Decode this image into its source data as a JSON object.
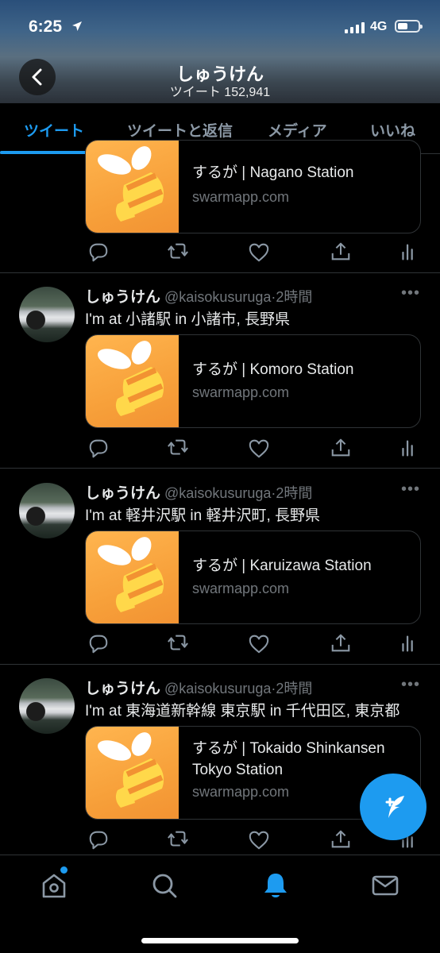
{
  "status_bar": {
    "time": "6:25",
    "network": "4G",
    "battery_level": 0.5
  },
  "header": {
    "profile_name": "しゅうけん",
    "tweet_count": "ツイート 152,941"
  },
  "tabs": [
    {
      "label": "ツイート",
      "active": true
    },
    {
      "label": "ツイートと返信",
      "active": false
    },
    {
      "label": "メディア",
      "active": false
    },
    {
      "label": "いいね",
      "active": false
    }
  ],
  "partial_tweet": {
    "card": {
      "title": "するが | Nagano Station",
      "domain": "swarmapp.com"
    }
  },
  "tweets": [
    {
      "name": "しゅうけん",
      "handle": "@kaisokusuruga",
      "separator": "·",
      "time": "2時間",
      "text": "I'm at 小諸駅 in 小諸市, 長野県",
      "card": {
        "title": "するが | Komoro Station",
        "domain": "swarmapp.com"
      }
    },
    {
      "name": "しゅうけん",
      "handle": "@kaisokusuruga",
      "separator": "·",
      "time": "2時間",
      "text": "I'm at 軽井沢駅 in 軽井沢町, 長野県",
      "card": {
        "title": "するが | Karuizawa Station",
        "domain": "swarmapp.com"
      }
    },
    {
      "name": "しゅうけん",
      "handle": "@kaisokusuruga",
      "separator": "·",
      "time": "2時間",
      "text": "I'm at 東海道新幹線 東京駅 in 千代田区, 東京都",
      "card": {
        "title": "するが | Tokaido Shinkansen Tokyo Station",
        "domain": "swarmapp.com"
      }
    }
  ],
  "colors": {
    "accent": "#1d9bf0",
    "swarm_orange": "#f7a03a",
    "bee_yellow": "#ffd84a",
    "muted": "#71767b"
  },
  "icons": {
    "nav": [
      "home-icon",
      "search-icon",
      "notifications-bell-icon",
      "messages-envelope-icon"
    ],
    "actions": [
      "reply-icon",
      "retweet-icon",
      "like-icon",
      "share-icon",
      "analytics-icon"
    ]
  }
}
